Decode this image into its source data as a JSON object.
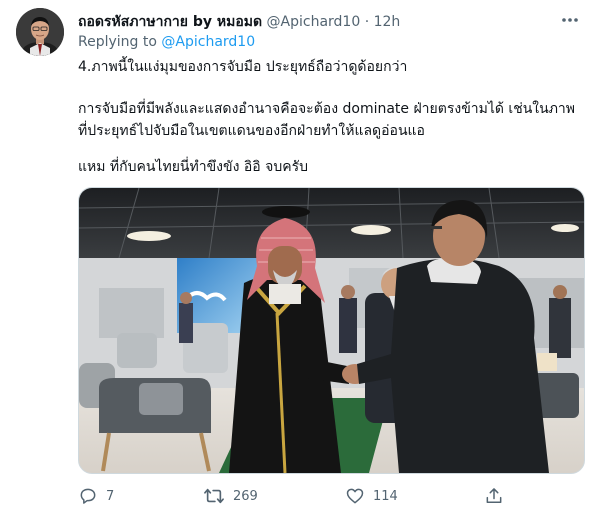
{
  "tweet": {
    "author_name": "ถอดรหัสภาษากาย by หมอมด",
    "author_handle": "@Apichard10",
    "separator": "·",
    "timestamp": "12h",
    "replying_prefix": "Replying to",
    "replying_to": "@Apichard10",
    "text": {
      "line1": "4.ภาพนี้ในแง่มุมของการจับมือ ประยุทธ์ถือว่าดูด้อยกว่า",
      "paragraph2": "การจับมือที่มีพลังและแสดงอำนาจคือจะต้อง dominate ฝ่ายตรงข้ามได้ เช่นในภาพที่ประยุทธ์ไปจับมือในเขตแดนของอีกฝ่ายทำให้แลดูอ่อนแอ",
      "paragraph3": "แหม ที่กับคนไทยนี่ทำขึงขัง อิอิ จบครับ"
    }
  },
  "actions": {
    "reply_count": "7",
    "retweet_count": "269",
    "like_count": "114"
  },
  "icons": {
    "more": "more-horizontal-icon",
    "reply": "reply-icon",
    "retweet": "retweet-icon",
    "like": "heart-icon",
    "share": "share-icon"
  },
  "colors": {
    "link": "#1d9bf0",
    "secondary_text": "#536471",
    "primary_text": "#0f1419"
  }
}
